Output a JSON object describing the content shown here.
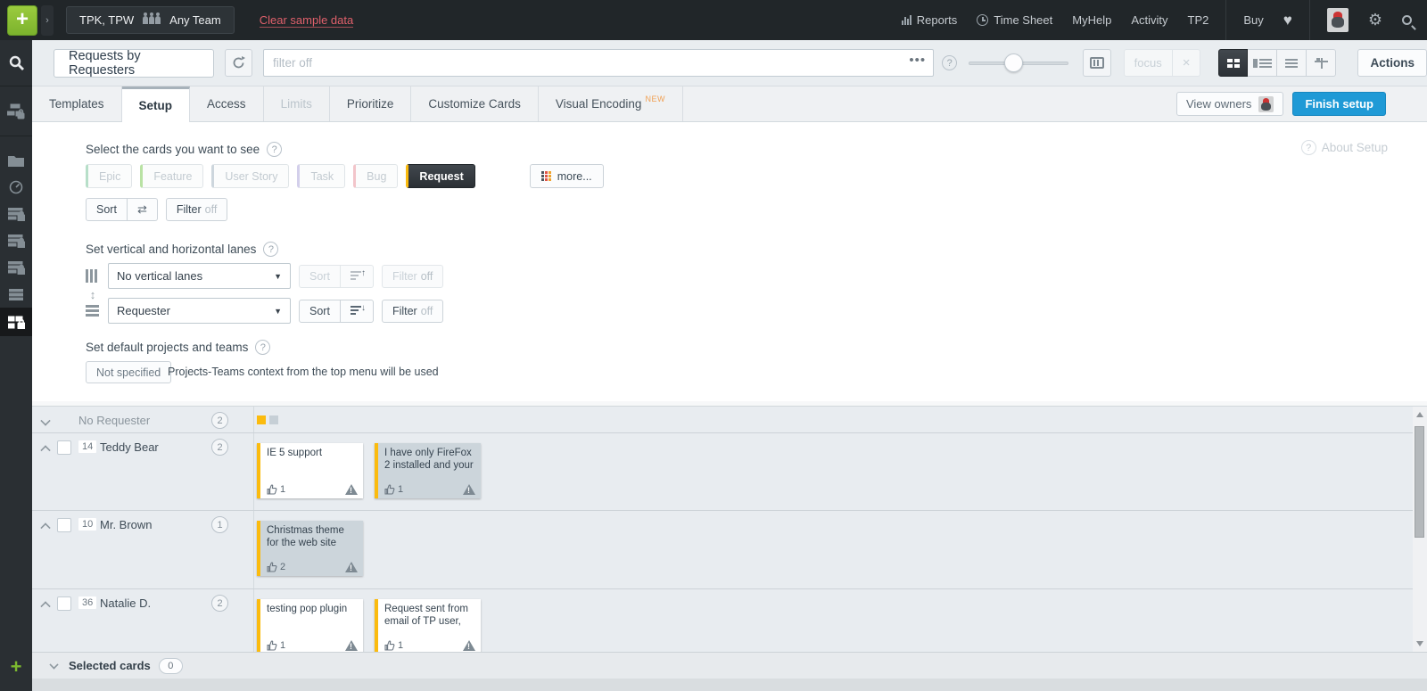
{
  "topbar": {
    "context_projects": "TPK, TPW",
    "context_team": "Any Team",
    "clear_link": "Clear sample data",
    "reports": "Reports",
    "time_sheet": "Time Sheet",
    "myhelp": "MyHelp",
    "activity": "Activity",
    "tp2": "TP2",
    "buy": "Buy"
  },
  "toolbar": {
    "title": "Requests by Requesters",
    "filter_placeholder": "filter off",
    "focus": "focus",
    "actions": "Actions"
  },
  "tabs": {
    "templates": "Templates",
    "setup": "Setup",
    "access": "Access",
    "limits": "Limits",
    "prioritize": "Prioritize",
    "customize": "Customize Cards",
    "visual": "Visual Encoding",
    "new_badge": "NEW",
    "view_owners": "View owners",
    "finish": "Finish setup"
  },
  "setup": {
    "about": "About Setup",
    "cards": {
      "title": "Select the cards you want to see",
      "types": [
        {
          "label": "Epic",
          "edge": "#b7dfc9"
        },
        {
          "label": "Feature",
          "edge": "#b9e2a4"
        },
        {
          "label": "User Story",
          "edge": "#cdd6dd"
        },
        {
          "label": "Task",
          "edge": "#d3cfeb"
        },
        {
          "label": "Bug",
          "edge": "#f2c5ca"
        },
        {
          "label": "Request",
          "edge": "#fbbb0e"
        }
      ],
      "more": "more...",
      "sort": "Sort",
      "filter": "Filter",
      "filter_state": "off"
    },
    "lanes": {
      "title": "Set vertical and horizontal lanes",
      "vertical_value": "No vertical lanes",
      "horizontal_value": "Requester",
      "sort": "Sort",
      "filter": "Filter",
      "filter_state": "off"
    },
    "defaults": {
      "title": "Set default projects and teams",
      "button": "Not specified",
      "hint": "Projects-Teams context from the top menu will be used"
    }
  },
  "board": {
    "rows": [
      {
        "name": "No Requester",
        "count": "2"
      },
      {
        "name": "Teddy Bear",
        "id": "14",
        "count": "2",
        "cards": [
          {
            "title": "IE 5 support",
            "likes": "1"
          },
          {
            "title": "I have only FireFox 2 installed and your",
            "likes": "1"
          }
        ]
      },
      {
        "name": "Mr. Brown",
        "id": "10",
        "count": "1",
        "cards": [
          {
            "title": "Christmas theme for the web site",
            "likes": "2"
          }
        ]
      },
      {
        "name": "Natalie D.",
        "id": "36",
        "count": "2",
        "cards": [
          {
            "title": "testing pop plugin",
            "likes": "1"
          },
          {
            "title": "Request sent from email of TP user,",
            "likes": "1"
          }
        ]
      }
    ]
  },
  "footer": {
    "label": "Selected cards",
    "count": "0"
  },
  "colors": {
    "accent_blue": "#1f9ad6",
    "card_edge_yellow": "#fbbb0e",
    "link_red": "#e0606b",
    "selected_dark": "#2b3035"
  }
}
